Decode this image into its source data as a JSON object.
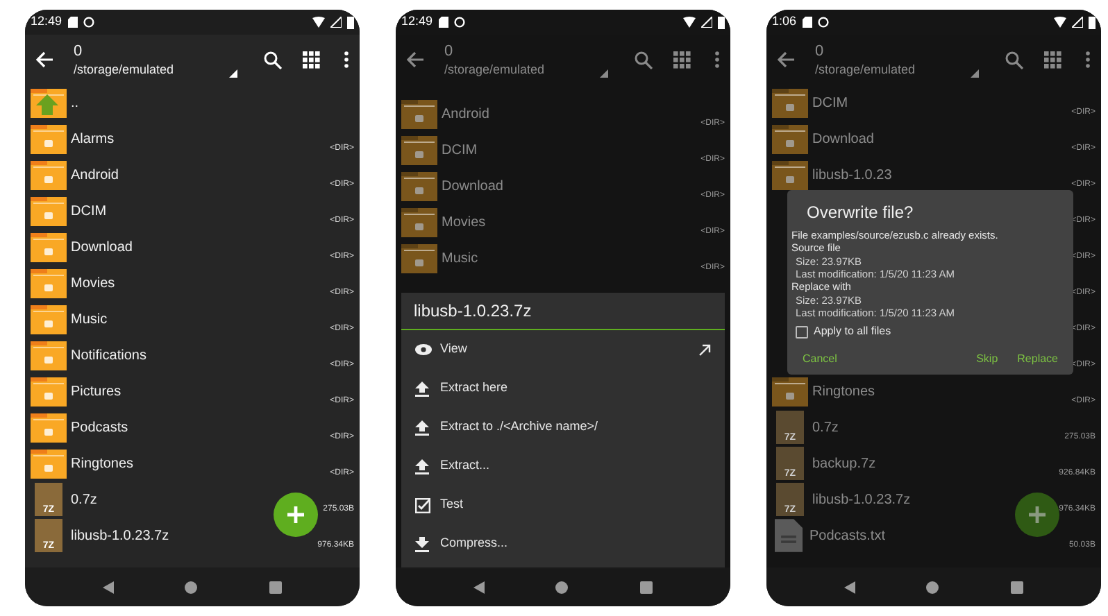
{
  "phones": [
    {
      "status_time": "12:49",
      "dimmed": false,
      "toolbar": {
        "title": "0",
        "path": "/storage/emulated"
      },
      "fab": true,
      "rows": [
        {
          "kind": "up",
          "name": ".."
        },
        {
          "kind": "folder",
          "name": "Alarms",
          "size": "<DIR>"
        },
        {
          "kind": "folder",
          "name": "Android",
          "size": "<DIR>"
        },
        {
          "kind": "folder",
          "name": "DCIM",
          "size": "<DIR>"
        },
        {
          "kind": "folder",
          "name": "Download",
          "size": "<DIR>"
        },
        {
          "kind": "folder",
          "name": "Movies",
          "size": "<DIR>"
        },
        {
          "kind": "folder",
          "name": "Music",
          "size": "<DIR>"
        },
        {
          "kind": "folder",
          "name": "Notifications",
          "size": "<DIR>"
        },
        {
          "kind": "folder",
          "name": "Pictures",
          "size": "<DIR>"
        },
        {
          "kind": "folder",
          "name": "Podcasts",
          "size": "<DIR>"
        },
        {
          "kind": "folder",
          "name": "Ringtones",
          "size": "<DIR>"
        },
        {
          "kind": "archive",
          "name": "0.7z",
          "size": "275.03B",
          "icon_label": "7Z"
        },
        {
          "kind": "archive",
          "name": "libusb-1.0.23.7z",
          "size": "976.34KB",
          "icon_label": "7Z"
        }
      ]
    },
    {
      "status_time": "12:49",
      "dimmed": true,
      "toolbar": {
        "title": "0",
        "path": "/storage/emulated"
      },
      "fab": false,
      "rows": [
        {
          "kind": "folder",
          "name": "Android",
          "size": "<DIR>"
        },
        {
          "kind": "folder",
          "name": "DCIM",
          "size": "<DIR>"
        },
        {
          "kind": "folder",
          "name": "Download",
          "size": "<DIR>"
        },
        {
          "kind": "folder",
          "name": "Movies",
          "size": "<DIR>"
        },
        {
          "kind": "folder",
          "name": "Music",
          "size": "<DIR>"
        }
      ],
      "sheet": {
        "title": "libusb-1.0.23.7z",
        "items": [
          {
            "kind": "view",
            "label": "View",
            "external": true
          },
          {
            "kind": "extract",
            "label": "Extract here",
            "external": false
          },
          {
            "kind": "extract",
            "label": "Extract to ./<Archive name>/",
            "external": false
          },
          {
            "kind": "extract",
            "label": "Extract...",
            "external": false
          },
          {
            "kind": "test",
            "label": "Test",
            "external": false
          },
          {
            "kind": "compress",
            "label": "Compress...",
            "external": false
          }
        ]
      }
    },
    {
      "status_time": "1:06",
      "dimmed": true,
      "toolbar": {
        "title": "0",
        "path": "/storage/emulated"
      },
      "fab": true,
      "rows": [
        {
          "kind": "folder",
          "name": "DCIM",
          "size": "<DIR>"
        },
        {
          "kind": "folder",
          "name": "Download",
          "size": "<DIR>"
        },
        {
          "kind": "folder",
          "name": "libusb-1.0.23",
          "size": "<DIR>"
        },
        {
          "kind": "folder",
          "size": "<DIR>"
        },
        {
          "kind": "folder",
          "size": "<DIR>"
        },
        {
          "kind": "folder",
          "size": "<DIR>"
        },
        {
          "kind": "folder",
          "size": "<DIR>"
        },
        {
          "kind": "folder",
          "size": "<DIR>"
        },
        {
          "kind": "folder",
          "name": "Ringtones",
          "size": "<DIR>"
        },
        {
          "kind": "archive",
          "name": "0.7z",
          "size": "275.03B",
          "icon_label": "7Z"
        },
        {
          "kind": "archive",
          "name": "backup.7z",
          "size": "926.84KB",
          "icon_label": "7Z"
        },
        {
          "kind": "archive",
          "name": "libusb-1.0.23.7z",
          "size": "976.34KB",
          "icon_label": "7Z"
        },
        {
          "kind": "text",
          "name": "Podcasts.txt",
          "size": "50.03B"
        }
      ],
      "dialog": {
        "title": "Overwrite file?",
        "message": "File examples/source/ezusb.c already exists.",
        "sections": [
          {
            "heading": "Source file",
            "lines": [
              "Size: 23.97KB",
              "Last modification: 1/5/20 11:23 AM"
            ]
          },
          {
            "heading": "Replace with",
            "lines": [
              "Size: 23.97KB",
              "Last modification: 1/5/20 11:23 AM"
            ]
          }
        ],
        "checkbox": {
          "label": "Apply to all files",
          "checked": false
        },
        "buttons": [
          "Cancel",
          "Skip",
          "Replace"
        ]
      }
    }
  ]
}
